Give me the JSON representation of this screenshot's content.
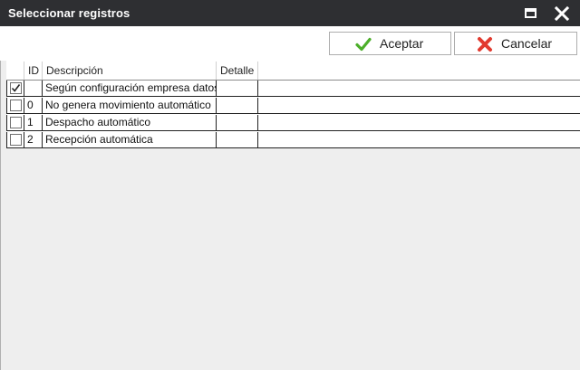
{
  "window": {
    "title": "Seleccionar registros",
    "maximize_icon": "maximize-icon",
    "close_icon": "close-icon"
  },
  "toolbar": {
    "accept_label": "Aceptar",
    "accept_icon": "checkmark-icon",
    "accept_icon_color": "#4caf2a",
    "cancel_label": "Cancelar",
    "cancel_icon": "x-icon",
    "cancel_icon_color": "#e23a2f"
  },
  "grid": {
    "columns": {
      "select": "",
      "id": "ID",
      "description": "Descripción",
      "detail": "Detalle"
    },
    "rows": [
      {
        "checked": true,
        "id": "",
        "description": "Según configuración empresa datos",
        "detail": ""
      },
      {
        "checked": false,
        "id": "0",
        "description": "No genera movimiento automático",
        "detail": ""
      },
      {
        "checked": false,
        "id": "1",
        "description": "Despacho automático",
        "detail": ""
      },
      {
        "checked": false,
        "id": "2",
        "description": "Recepción automática",
        "detail": ""
      }
    ]
  }
}
